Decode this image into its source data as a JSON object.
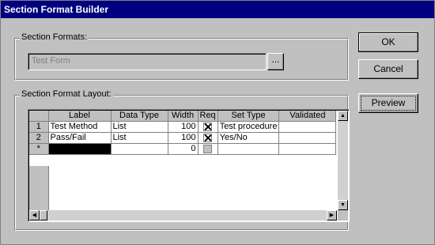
{
  "window": {
    "title": "Section Format Builder"
  },
  "formats": {
    "legend": "Section Formats:",
    "value": "Test Form",
    "browse_label": "..."
  },
  "buttons": {
    "ok": "OK",
    "cancel": "Cancel",
    "preview": "Preview"
  },
  "layout": {
    "legend": "Section Format Layout:",
    "columns": [
      "Label",
      "Data Type",
      "Width",
      "Req",
      "Set Type",
      "Validated"
    ],
    "rows": [
      {
        "header": "1",
        "label": "Test Method",
        "data_type": "List",
        "width": "100",
        "req": true,
        "set_type": "Test procedure",
        "validated": ""
      },
      {
        "header": "2",
        "label": "Pass/Fail",
        "data_type": "List",
        "width": "100",
        "req": true,
        "set_type": "Yes/No",
        "validated": ""
      },
      {
        "header": "*",
        "label": "",
        "data_type": "",
        "width": "0",
        "req": false,
        "set_type": "",
        "validated": ""
      }
    ]
  },
  "icons": {
    "scroll_up": "arrow-up-icon",
    "scroll_down": "arrow-down-icon",
    "scroll_left": "arrow-left-icon",
    "scroll_right": "arrow-right-icon"
  },
  "colors": {
    "titlebar": "#000080",
    "face": "#c0c0c0",
    "new_row_cell": "#000000"
  }
}
